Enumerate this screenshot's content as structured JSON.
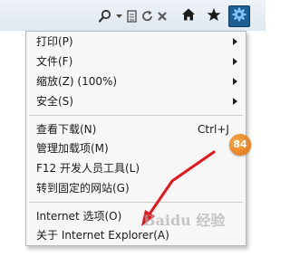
{
  "toolbar": {
    "icons": [
      "search-icon",
      "dropdown-caret-icon",
      "compat-view-icon",
      "refresh-icon",
      "close-icon"
    ],
    "buttons": [
      "home-icon",
      "favorites-star-icon",
      "gear-icon"
    ],
    "accent": "#1e5f92"
  },
  "menu": {
    "items": [
      {
        "label": "打印(P)",
        "submenu": true
      },
      {
        "label": "文件(F)",
        "submenu": true
      },
      {
        "label": "缩放(Z) (100%)",
        "submenu": true
      },
      {
        "label": "安全(S)",
        "submenu": true
      },
      {
        "label": "查看下载(N)",
        "shortcut": "Ctrl+J"
      },
      {
        "label": "管理加载项(M)"
      },
      {
        "label": "F12 开发人员工具(L)"
      },
      {
        "label": "转到固定的网站(G)"
      },
      {
        "label": "Internet 选项(O)"
      },
      {
        "label": "关于 Internet Explorer(A)"
      }
    ]
  },
  "badge": {
    "text": "84",
    "color": "#e06d10"
  },
  "annotation": {
    "arrow_color": "#e8141b"
  },
  "watermark": {
    "text": "Baidu 经验"
  }
}
